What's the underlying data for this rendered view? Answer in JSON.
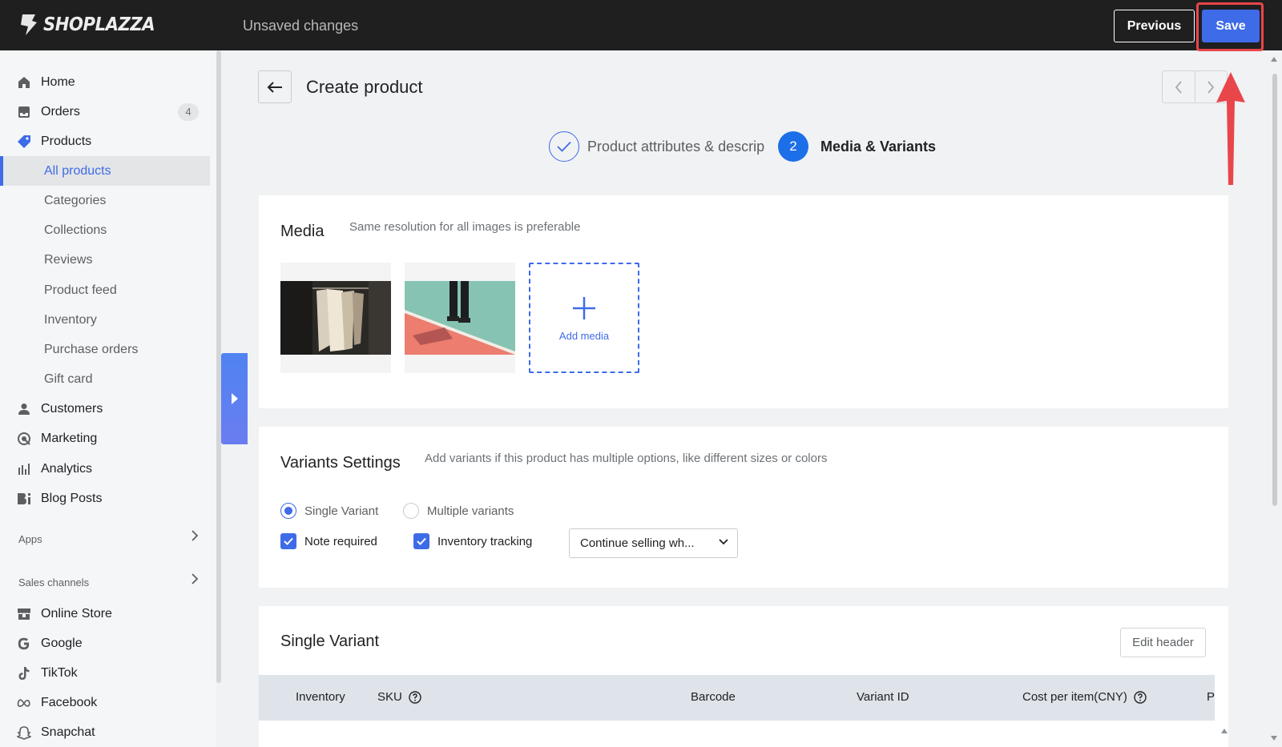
{
  "header": {
    "logo_text": "SHOPLAZZA",
    "status": "Unsaved changes",
    "previous_label": "Previous",
    "save_label": "Save"
  },
  "sidebar": {
    "items": [
      {
        "label": "Home",
        "icon": "home-icon"
      },
      {
        "label": "Orders",
        "icon": "orders-icon",
        "badge": "4"
      },
      {
        "label": "Products",
        "icon": "tag-icon"
      },
      {
        "label": "All products",
        "active": true
      },
      {
        "label": "Categories"
      },
      {
        "label": "Collections"
      },
      {
        "label": "Reviews"
      },
      {
        "label": "Product feed"
      },
      {
        "label": "Inventory"
      },
      {
        "label": "Purchase orders"
      },
      {
        "label": "Gift card"
      },
      {
        "label": "Customers",
        "icon": "person-icon"
      },
      {
        "label": "Marketing",
        "icon": "marketing-icon"
      },
      {
        "label": "Analytics",
        "icon": "analytics-icon"
      },
      {
        "label": "Blog Posts",
        "icon": "blog-icon"
      }
    ],
    "apps_label": "Apps",
    "sales_channels_label": "Sales channels",
    "channels": [
      {
        "label": "Online Store",
        "icon": "store-icon"
      },
      {
        "label": "Google",
        "icon": "google-icon"
      },
      {
        "label": "TikTok",
        "icon": "tiktok-icon"
      },
      {
        "label": "Facebook",
        "icon": "meta-icon"
      },
      {
        "label": "Snapchat",
        "icon": "snapchat-icon"
      }
    ]
  },
  "page": {
    "title": "Create product",
    "steps": [
      {
        "label": "Product attributes & descrip",
        "state": "done"
      },
      {
        "number": "2",
        "label": "Media & Variants",
        "state": "current"
      }
    ]
  },
  "media": {
    "title": "Media",
    "hint": "Same resolution for all images is preferable",
    "add_label": "Add media"
  },
  "variants_settings": {
    "title": "Variants Settings",
    "hint": "Add variants if this product has multiple options, like different sizes or colors",
    "single_label": "Single Variant",
    "multiple_label": "Multiple variants",
    "note_required_label": "Note required",
    "inventory_tracking_label": "Inventory tracking",
    "policy_value": "Continue selling wh..."
  },
  "single_variant": {
    "title": "Single Variant",
    "edit_header_label": "Edit header",
    "columns": [
      "Inventory",
      "SKU",
      "Barcode",
      "Variant ID",
      "Cost per item(CNY)",
      "P"
    ]
  },
  "colors": {
    "accent": "#3e6be8",
    "topbar": "#1f1f1f",
    "highlight": "#e8464a"
  }
}
